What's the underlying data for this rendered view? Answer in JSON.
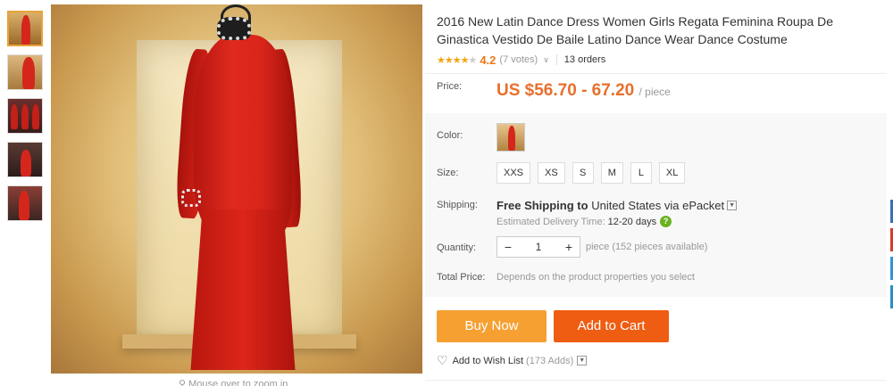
{
  "thumbnails": [
    {
      "name": "thumb-1",
      "active": true
    },
    {
      "name": "thumb-2",
      "active": false
    },
    {
      "name": "thumb-3",
      "active": false
    },
    {
      "name": "thumb-4",
      "active": false
    },
    {
      "name": "thumb-5",
      "active": false
    }
  ],
  "image": {
    "zoom_hint": "Mouse over to zoom in"
  },
  "product": {
    "title": "2016 New Latin Dance Dress Women Girls Regata Feminina Roupa De Ginastica Vestido De Baile Latino Dance Wear Dance Costume",
    "rating": "4.2",
    "rating_fraction": 0.84,
    "votes": "(7 votes)",
    "orders": "13 orders"
  },
  "price": {
    "label": "Price:",
    "value": "US $56.70 - 67.20",
    "unit": "/ piece"
  },
  "color": {
    "label": "Color:"
  },
  "size": {
    "label": "Size:",
    "options": [
      "XXS",
      "XS",
      "S",
      "M",
      "L",
      "XL"
    ]
  },
  "shipping": {
    "label": "Shipping:",
    "free": "Free Shipping",
    "to_word": "to",
    "country": "United States",
    "via_word": "via",
    "carrier": "ePacket",
    "estimate_label": "Estimated Delivery Time:",
    "estimate_days": "12-20 days"
  },
  "quantity": {
    "label": "Quantity:",
    "value": "1",
    "note": "piece (152 pieces available)"
  },
  "total": {
    "label": "Total Price:",
    "note": "Depends on the product properties you select"
  },
  "actions": {
    "buy_now": "Buy Now",
    "add_to_cart": "Add to Cart"
  },
  "wishlist": {
    "label": "Add to Wish List",
    "count": "(173 Adds)"
  },
  "colors": {
    "accent_price": "#e86f2c",
    "buy_now": "#f6a032",
    "add_to_cart": "#ee5d12",
    "star": "#f2a511"
  },
  "icons": {
    "heart": "heart-icon",
    "help": "help-icon",
    "search": "search-icon"
  }
}
